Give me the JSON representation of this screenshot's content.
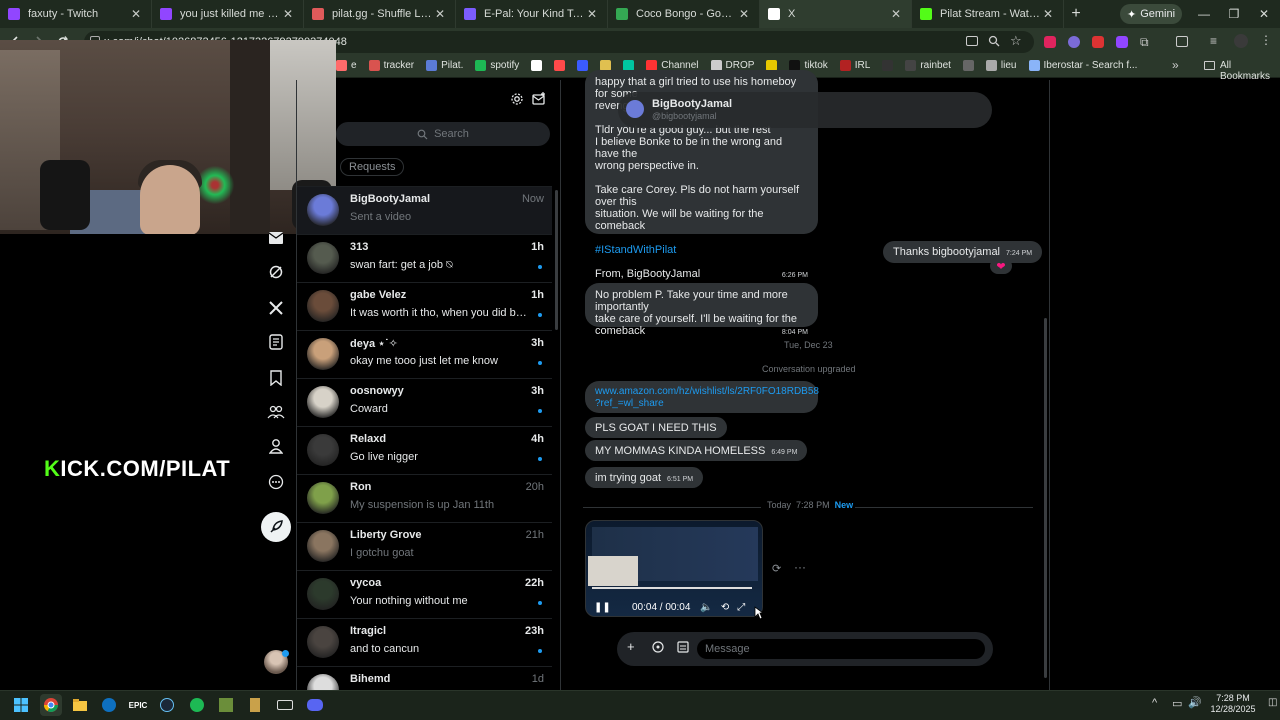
{
  "browser": {
    "tabs": [
      {
        "title": "faxuty - Twitch",
        "fav": "#9146ff"
      },
      {
        "title": "you just killed me you - Twitch",
        "fav": "#9146ff"
      },
      {
        "title": "pilat.gg - Shuffle Leaderboard",
        "fav": "#e05a5a"
      },
      {
        "title": "E-Pal: Your Kind Teammates",
        "fav": "#7b5cff"
      },
      {
        "title": "Coco Bongo - Google Maps",
        "fav": "#34a853"
      },
      {
        "title": "X",
        "fav": "#ffffff"
      },
      {
        "title": "Pilat Stream - Watch Live on",
        "fav": "#53fc18"
      }
    ],
    "gemini_label": "Gemini",
    "url": "x.com/i/chat/1026872456-1217326792790274048",
    "bookmarks": [
      {
        "label": "e",
        "fav": "#ff6b6b"
      },
      {
        "label": "tracker",
        "fav": "#d9534f"
      },
      {
        "label": "Pilat.",
        "fav": "#5b7bd5"
      },
      {
        "label": "spotify",
        "fav": "#1db954"
      },
      {
        "label": "",
        "fav": "#ffffff"
      },
      {
        "label": "",
        "fav": "#ff4a4a"
      },
      {
        "label": "",
        "fav": "#3b5bff"
      },
      {
        "label": "",
        "fav": "#e0c050"
      },
      {
        "label": "",
        "fav": "#00c7a0"
      },
      {
        "label": "Channel",
        "fav": "#ff3333"
      },
      {
        "label": "DROP",
        "fav": "#cccccc"
      },
      {
        "label": "",
        "fav": "#e6c800"
      },
      {
        "label": "tiktok",
        "fav": "#111111"
      },
      {
        "label": "IRL",
        "fav": "#b22222"
      },
      {
        "label": "",
        "fav": "#333333"
      },
      {
        "label": "rainbet",
        "fav": "#444444"
      },
      {
        "label": "",
        "fav": "#666666"
      },
      {
        "label": "lieu",
        "fav": "#aaaaaa"
      },
      {
        "label": "Iberostar - Search f...",
        "fav": "#8ab4f8"
      }
    ],
    "all_bookmarks": "All Bookmarks"
  },
  "overlay": {
    "kick_k": "K",
    "kick_rest": "ICK.COM/PILAT"
  },
  "dm": {
    "search_placeholder": "Search",
    "requests_label": "Requests",
    "conversations": [
      {
        "name": "BigBootyJamal",
        "preview": "Sent a video",
        "time": "Now",
        "unread": false,
        "selected": true,
        "av": "#6b7bd8"
      },
      {
        "name": "313",
        "preview": "swan fart: get a job ⍉",
        "time": "1h",
        "unread": true,
        "av": "#555b4f"
      },
      {
        "name": "gabe Velez",
        "preview": "It was worth it tho, when you did banana ...",
        "time": "1h",
        "unread": true,
        "av": "#6a4c3a"
      },
      {
        "name": "deya ⋆˙✧",
        "preview": "okay me tooo just let me know",
        "time": "3h",
        "unread": true,
        "av": "#c9a07a"
      },
      {
        "name": "oosnowyy",
        "preview": "Coward",
        "time": "3h",
        "unread": true,
        "av": "#d7d2c8"
      },
      {
        "name": "Relaxd",
        "preview": "Go live nigger",
        "time": "4h",
        "unread": true,
        "av": "#3a3a3a"
      },
      {
        "name": "Ron",
        "preview": "My suspension is up Jan 11th",
        "time": "20h",
        "unread": false,
        "av": "#7fa04a"
      },
      {
        "name": "Liberty Grove",
        "preview": "I gotchu goat",
        "time": "21h",
        "unread": false,
        "av": "#8a7560"
      },
      {
        "name": "vycoa",
        "preview": "Your nothing without me",
        "time": "22h",
        "unread": true,
        "av": "#2c3a2c"
      },
      {
        "name": "Itragicl",
        "preview": "and to cancun",
        "time": "23h",
        "unread": true,
        "av": "#4a4440"
      },
      {
        "name": "Bihemd",
        "preview": "",
        "time": "1d",
        "unread": false,
        "av": "#dddddd"
      }
    ]
  },
  "chat": {
    "header_name": "BigBootyJamal",
    "header_handle": "@bigbootyjamal",
    "msg1": {
      "lines": [
        "happy that a girl tried to use his homeboy for some",
        "revenge."
      ],
      "tldr": "Tldr you're a good guy... but the rest",
      "tldr2": "I believe Bonke to be in the wrong and have the",
      "tldr3": "wrong perspective in.",
      "take1": "Take care Corey. Pls do not harm yourself over this",
      "take2": "situation. We will be waiting for the comeback",
      "hashtag": "#IStandWithPilat",
      "from": "From, BigBootyJamal",
      "time": "6:26 PM"
    },
    "out1": {
      "text": "Thanks bigbootyjamal",
      "time": "7:24 PM",
      "reaction": "❤"
    },
    "msg2": {
      "l1": "No problem P. Take your time and more importantly",
      "l2": "take care of yourself. I'll be waiting for the",
      "l3": "comeback",
      "time": "8:04 PM"
    },
    "date_sep": "Tue, Dec 23",
    "conv_upgraded": "Conversation upgraded",
    "link1": "www.amazon.com/hz/wishlist/ls/2RF0FO18RDB58",
    "link2": "?ref_=wl_share",
    "msg3": "PLS GOAT I NEED THIS",
    "msg4": {
      "text": "MY MOMMAS KINDA HOMELESS",
      "time": "6:49 PM"
    },
    "msg5": {
      "text": "im trying goat",
      "time": "6:51 PM"
    },
    "today": "Today",
    "today_time": "7:28 PM",
    "new_label": "New",
    "video_time": "00:04 / 00:04",
    "composer_placeholder": "Message"
  },
  "taskbar": {
    "time": "7:28 PM",
    "date": "12/28/2025"
  }
}
